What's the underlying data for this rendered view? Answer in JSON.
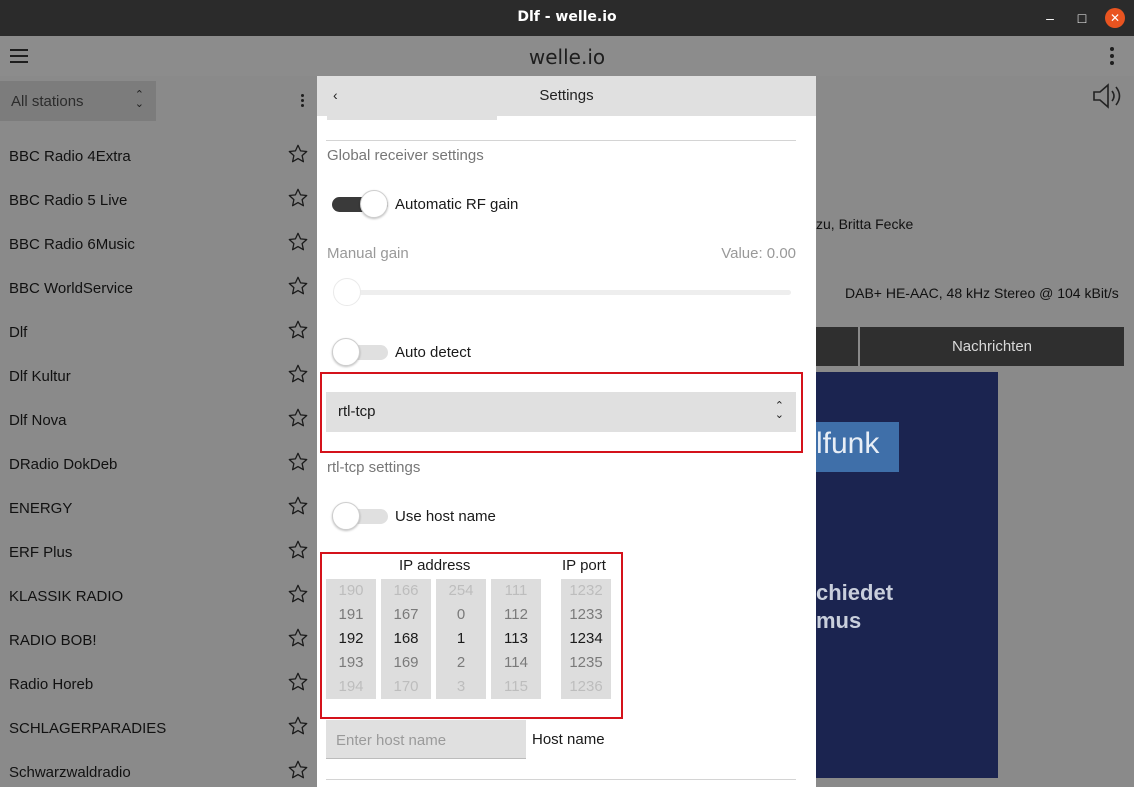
{
  "window": {
    "title": "Dlf - welle.io",
    "minimize": "–",
    "maximize": "□",
    "close": "✕"
  },
  "app": {
    "title": "welle.io"
  },
  "sidebar": {
    "filter": {
      "value": "All stations"
    },
    "stations": [
      {
        "name": "BBC Radio 4Extra"
      },
      {
        "name": "BBC Radio 5 Live"
      },
      {
        "name": "BBC Radio 6Music"
      },
      {
        "name": "BBC WorldService"
      },
      {
        "name": "Dlf"
      },
      {
        "name": "Dlf Kultur"
      },
      {
        "name": "Dlf Nova"
      },
      {
        "name": "DRadio DokDeb"
      },
      {
        "name": "ENERGY"
      },
      {
        "name": "ERF Plus"
      },
      {
        "name": "KLASSIK RADIO"
      },
      {
        "name": "RADIO BOB!"
      },
      {
        "name": "Radio Horeb"
      },
      {
        "name": "SCHLAGERPARADIES"
      },
      {
        "name": "Schwarzwaldradio"
      }
    ]
  },
  "main": {
    "artist_text": "zu, Britta Fecke",
    "codec_text": "DAB+ HE-AAC, 48 kHz Stereo @ 104 kBit/s",
    "tab_label": "Nachrichten",
    "slide": {
      "brand": "lfunk",
      "line1": "chiedet",
      "line2": "mus"
    }
  },
  "settings": {
    "back": "‹",
    "title": "Settings",
    "global_section": "Global receiver settings",
    "auto_rf_gain": {
      "label": "Automatic RF gain",
      "on": true
    },
    "manual_gain": {
      "label": "Manual gain",
      "value_text": "Value:  0.00",
      "value": 0.0
    },
    "auto_detect": {
      "label": "Auto detect",
      "on": false
    },
    "device": {
      "value": "rtl-tcp"
    },
    "rtl_section": "rtl-tcp settings",
    "use_host_name": {
      "label": "Use host name",
      "on": false
    },
    "ip_address_label": "IP address",
    "ip_port_label": "IP port",
    "ip_octets": [
      {
        "values": [
          "190",
          "191",
          "192",
          "193",
          "194"
        ]
      },
      {
        "values": [
          "166",
          "167",
          "168",
          "169",
          "170"
        ]
      },
      {
        "values": [
          "254",
          "0",
          "1",
          "2",
          "3"
        ]
      },
      {
        "values": [
          "111",
          "112",
          "113",
          "114",
          "115"
        ]
      }
    ],
    "ip_port": {
      "values": [
        "1232",
        "1233",
        "1234",
        "1235",
        "1236"
      ]
    },
    "host_name": {
      "placeholder": "Enter host name",
      "label": "Host name"
    }
  },
  "colors": {
    "highlight": "#d4121b",
    "toggle_on": "#3a3a3a",
    "dialog_header": "#e0e0e0"
  }
}
